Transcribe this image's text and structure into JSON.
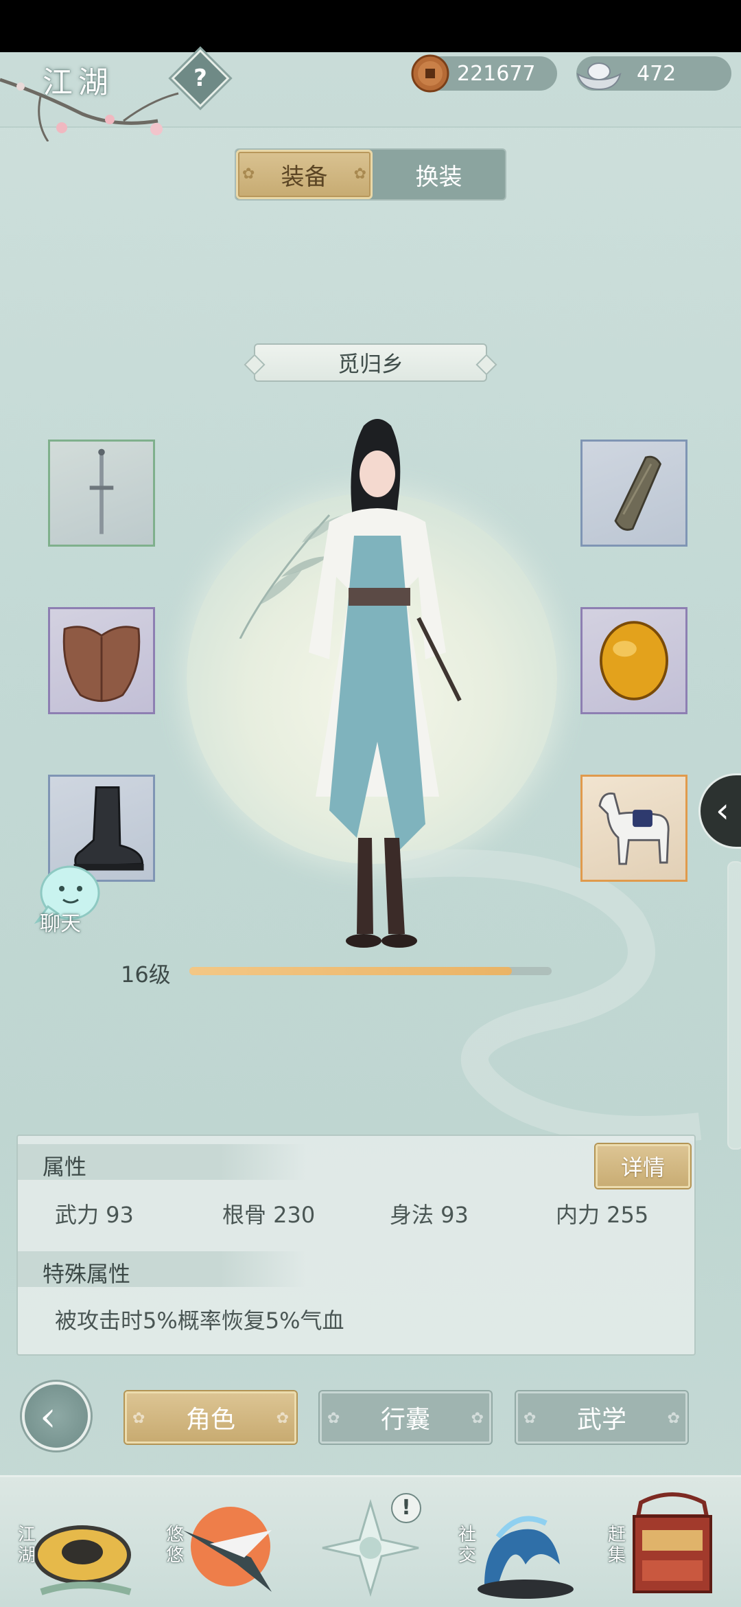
{
  "header": {
    "title": "江湖",
    "help_symbol": "?",
    "copper": "221677",
    "silver": "472"
  },
  "equip_tabs": [
    "装备",
    "换装"
  ],
  "active_equip_tab": "装备",
  "location": "觅归乡",
  "slots": {
    "left": [
      {
        "name": "sword",
        "icon": "sword-icon",
        "rarity": "green"
      },
      {
        "name": "armor",
        "icon": "leather-armor-icon",
        "rarity": "purple"
      },
      {
        "name": "boots",
        "icon": "boot-icon",
        "rarity": "blue"
      }
    ],
    "right": [
      {
        "name": "bracer",
        "icon": "bracer-icon",
        "rarity": "blue"
      },
      {
        "name": "jade",
        "icon": "amber-gem-icon",
        "rarity": "purple"
      },
      {
        "name": "mount",
        "icon": "horse-icon",
        "rarity": "orange"
      }
    ]
  },
  "chat": {
    "label": "聊天"
  },
  "level": {
    "text": "16级",
    "progress_fraction": 0.89
  },
  "attributes": {
    "section_title": "属性",
    "detail_button": "详情",
    "stats": [
      {
        "text": "武力 93"
      },
      {
        "text": "根骨 230"
      },
      {
        "text": "身法 93"
      },
      {
        "text": "内力 255"
      }
    ],
    "special_title": "特殊属性",
    "special_text": "被攻击时5%概率恢复5%气血"
  },
  "bottom_tabs": [
    "角色",
    "行囊",
    "武学"
  ],
  "active_bottom_tab": "角色",
  "nav": [
    {
      "label": "江湖",
      "icon": "straw-hat-icon"
    },
    {
      "label": "悠悠",
      "icon": "crane-icon"
    },
    {
      "label": "",
      "icon": "compass-star-icon",
      "alert": "!"
    },
    {
      "label": "社交",
      "icon": "wave-icon"
    },
    {
      "label": "赶集",
      "icon": "market-basket-icon"
    }
  ],
  "colors": {
    "background": "#c3d9d5",
    "gold": "#c9ad74",
    "panel": "#e4ece9",
    "accent_orange": "#e09a4c"
  }
}
